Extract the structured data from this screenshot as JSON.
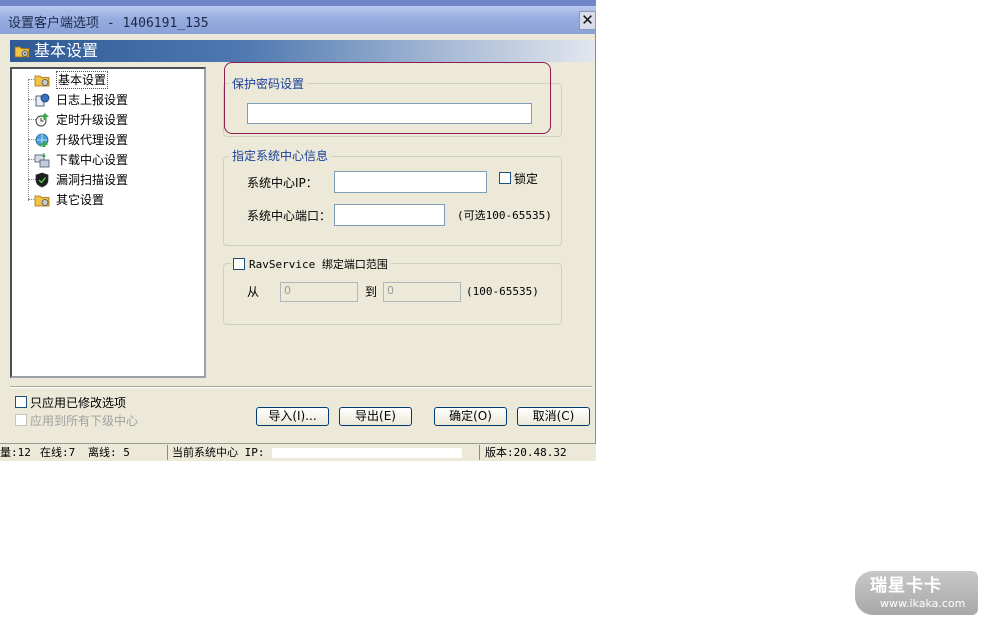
{
  "window": {
    "title": "设置客户端选项 - 1406191_135",
    "close_glyph": "✕"
  },
  "header": {
    "title": "基本设置",
    "icon": "folder-gear-icon"
  },
  "tree": {
    "items": [
      {
        "label": "基本设置",
        "icon": "folder-gear-icon",
        "selected": true
      },
      {
        "label": "日志上报设置",
        "icon": "log-report-icon"
      },
      {
        "label": "定时升级设置",
        "icon": "scheduled-upgrade-icon"
      },
      {
        "label": "升级代理设置",
        "icon": "upgrade-proxy-icon"
      },
      {
        "label": "下载中心设置",
        "icon": "download-center-icon"
      },
      {
        "label": "漏洞扫描设置",
        "icon": "vulnerability-scan-icon"
      },
      {
        "label": "其它设置",
        "icon": "folder-gear-icon"
      }
    ]
  },
  "password_group": {
    "legend": "保护密码设置",
    "value": ""
  },
  "center_group": {
    "legend": "指定系统中心信息",
    "ip_label": "系统中心IP：",
    "ip_value": "",
    "lock_label": "锁定",
    "port_label": "系统中心端口：",
    "port_value": "",
    "port_hint": "(可选100-65535)"
  },
  "bind_group": {
    "legend": "RavService 绑定端口范围",
    "from_label": "从",
    "from_value": "0",
    "to_label": "到",
    "to_value": "0",
    "range_hint": "(100-65535)"
  },
  "options": {
    "only_modified": "只应用已修改选项",
    "apply_all": "应用到所有下级中心"
  },
  "buttons": {
    "import": "导入(I)...",
    "export": "导出(E)",
    "ok": "确定(O)",
    "cancel": "取消(C)"
  },
  "status": {
    "total": "量:12",
    "online": "在线:7",
    "offline": "离线: 5",
    "center_ip": "当前系统中心 IP:",
    "version": "版本:20.48.32"
  },
  "watermark": {
    "brand": "瑞星卡卡",
    "url": "www.ikaka.com"
  },
  "colors": {
    "banner": "#2e5a95",
    "legend_text": "#1a3f9a",
    "highlight": "#8b2052",
    "dialog_bg": "#ece9d8"
  }
}
